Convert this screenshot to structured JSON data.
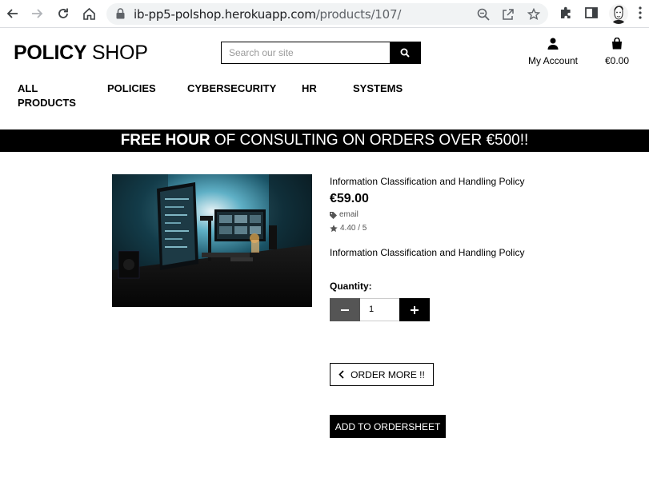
{
  "browser": {
    "url_host": "ib-pp5-polshop.herokuapp.com",
    "url_path": "/products/107/"
  },
  "site": {
    "logo_bold": "POLICY",
    "logo_light": " SHOP",
    "search_placeholder": "Search our site",
    "account_label": "My Account",
    "bag_total": "€0.00",
    "nav": [
      {
        "label": "ALL"
      },
      {
        "label": "PRODUCTS"
      },
      {
        "label": "POLICIES"
      },
      {
        "label": "CYBERSECURITY"
      },
      {
        "label": "HR"
      },
      {
        "label": "SYSTEMS"
      }
    ],
    "banner_bold": "FREE HOUR",
    "banner_rest": " OF CONSULTING ON ORDERS OVER €500!!"
  },
  "product": {
    "name": "Information Classification and Handling Policy",
    "price": "€59.00",
    "category": "email",
    "rating": "4.40 / 5",
    "description": "Information Classification and Handling Policy",
    "quantity_label": "Quantity:",
    "quantity_value": "1",
    "order_more_label": "ORDER MORE !!",
    "add_label": "ADD TO ORDERSHEET"
  }
}
